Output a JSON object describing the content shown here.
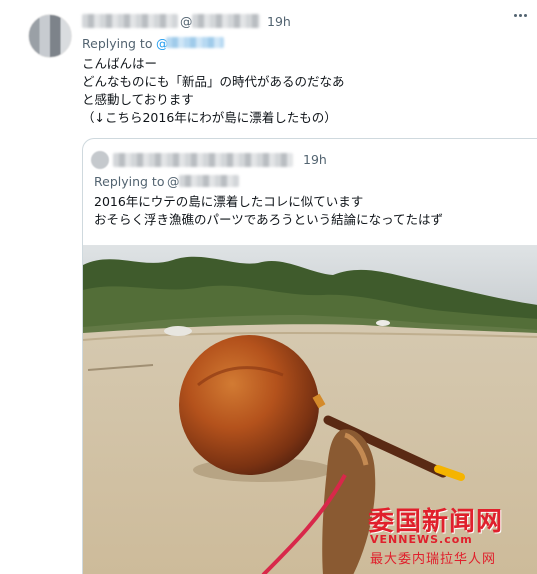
{
  "tweet": {
    "handle_prefix": "@",
    "time": "19h",
    "replying_to_label": "Replying to",
    "replying_to_prefix": "@",
    "lines": [
      "こんばんはー",
      "どんなものにも「新品」の時代があるのだなあ",
      "と感動しております",
      "（↓こちら2016年にわが島に漂着したもの）"
    ]
  },
  "quoted": {
    "time": "19h",
    "replying_to_label": "Replying to",
    "replying_to_prefix": "@",
    "lines": [
      "2016年にウテの島に漂着したコレに似ています",
      "おそらく浮き漁礁のパーツであろうという結論になってたはず"
    ]
  },
  "watermark": {
    "brand": "委国新闻网",
    "domain": "VENNEWS.com",
    "tagline": "最大委内瑞拉华人网"
  },
  "colors": {
    "link": "#1d9bf0",
    "secondary_text": "#536471",
    "border": "#cfd9de",
    "watermark": "#e0202c"
  },
  "icons": {
    "more": "more-dots-icon"
  }
}
